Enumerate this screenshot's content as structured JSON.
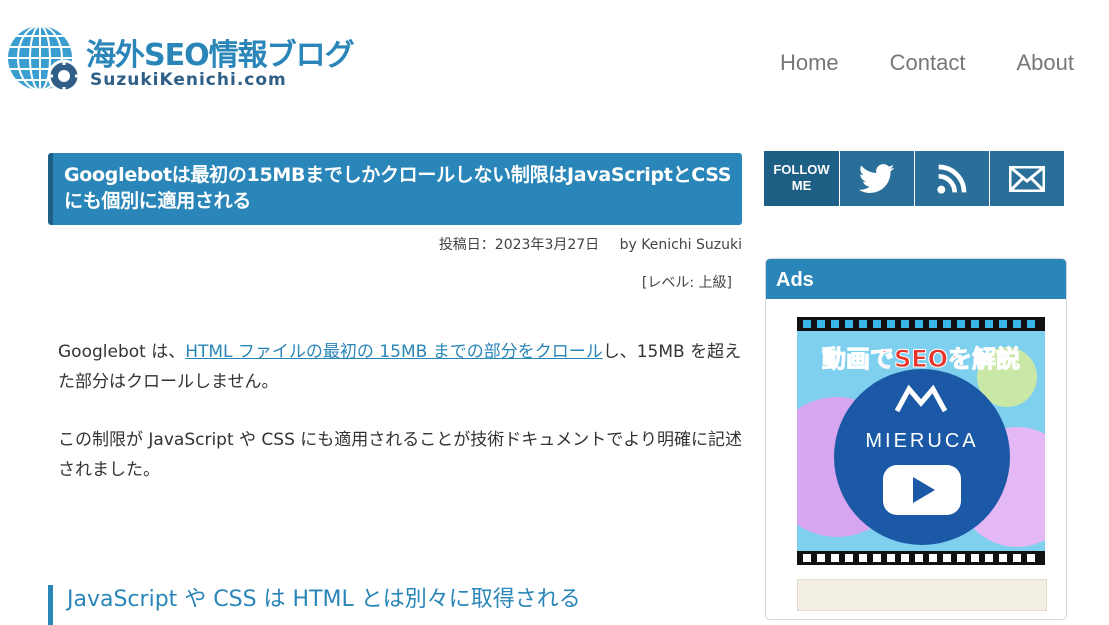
{
  "site": {
    "title": "海外SEO情報ブログ",
    "subtitle": "SuzukiKenichi.com"
  },
  "nav": [
    {
      "label": "Home"
    },
    {
      "label": "Contact"
    },
    {
      "label": "About"
    }
  ],
  "article": {
    "title": "Googlebotは最初の15MBまでしかクロールしない制限はJavaScriptとCSSにも個別に適用される",
    "post_date": "投稿日：2023年3月27日",
    "author": "by Kenichi Suzuki",
    "level": "[レベル: 上級]",
    "p1_pre": "Googlebot は、",
    "p1_link": "HTML ファイルの最初の 15MB までの部分をクロール",
    "p1_post": "し、15MB を超えた部分はクロールしません。",
    "p2": "この制限が JavaScript や CSS にも適用されることが技術ドキュメントでより明確に記述されました。",
    "h2": "JavaScript や CSS は HTML とは別々に取得される"
  },
  "sidebar": {
    "follow_label": "FOLLOW ME",
    "follow_icons": [
      "twitter-icon",
      "rss-icon",
      "mail-icon"
    ],
    "ads_title": "Ads",
    "ad_banner_text": "動画でSEOを解説",
    "ad_brand": "MIERUCA"
  },
  "colors": {
    "accent": "#2a86b8",
    "dark_accent": "#1e5f86",
    "nav_text": "#777777"
  }
}
